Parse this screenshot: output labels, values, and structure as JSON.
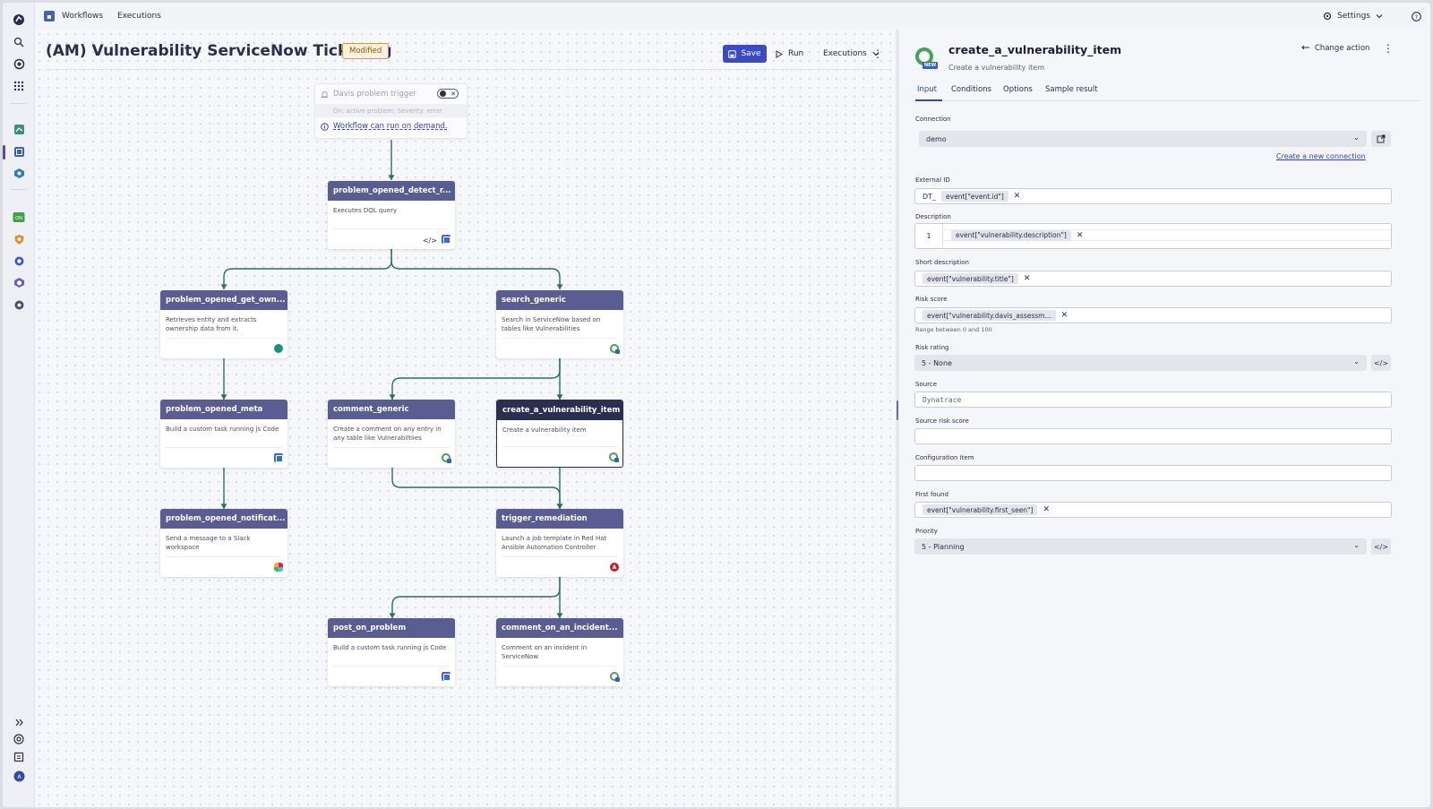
{
  "topbar": {
    "app_name": "Workflows",
    "nav_executions": "Executions",
    "settings_label": "Settings"
  },
  "editor": {
    "title": "(AM) Vulnerability ServiceNow Ticketing",
    "modified_badge": "Modified",
    "save_label": "Save",
    "run_label": "Run",
    "executions_label": "Executions"
  },
  "trigger": {
    "title": "Davis problem trigger",
    "subtitle": "On: active problem; Severity: error",
    "on_demand_link": "Workflow can run on demand."
  },
  "nodes": [
    {
      "title": "problem_opened_detect_r...",
      "desc": "Executes DQL query",
      "icon": "code-and-dynatrace-icons"
    },
    {
      "title": "problem_opened_get_own...",
      "desc": "Retrieves entity and extracts ownership data from it.",
      "icon": "globe-icon"
    },
    {
      "title": "search_generic",
      "desc": "Search in ServiceNow based on tables like Vulnerabilities",
      "icon": "servicenow-icon"
    },
    {
      "title": "problem_opened_meta",
      "desc": "Build a custom task running js Code",
      "icon": "dynatrace-icon"
    },
    {
      "title": "comment_generic",
      "desc": "Create a comment on any entry in any table like Vulnerabiltiies",
      "icon": "servicenow-icon"
    },
    {
      "title": "create_a_vulnerability_item",
      "desc": "Create a vulnerability item",
      "icon": "servicenow-icon"
    },
    {
      "title": "problem_opened_notificat...",
      "desc": "Send a message to a Slack workspace",
      "icon": "slack-icon"
    },
    {
      "title": "trigger_remediation",
      "desc": "Launch a job template in Red Hat Ansible Automation Controller",
      "icon": "ansible-icon"
    },
    {
      "title": "post_on_problem",
      "desc": "Build a custom task running js Code",
      "icon": "dynatrace-icon"
    },
    {
      "title": "comment_on_an_incident...",
      "desc": "Comment on an incident in ServiceNow",
      "icon": "servicenow-icon"
    }
  ],
  "panel": {
    "title": "create_a_vulnerability_item",
    "subtitle": "Create a vulnerability item",
    "new_badge": "NEW",
    "change_action": "Change action",
    "tabs": [
      "Input",
      "Conditions",
      "Options",
      "Sample result"
    ],
    "connection": {
      "label": "Connection",
      "value": "demo",
      "create_link": "Create a new connection"
    },
    "external_id": {
      "label": "External ID",
      "prefix": "DT_",
      "chip": "event[\"event.id\"]"
    },
    "description": {
      "label": "Description",
      "line_no": "1",
      "chip": "event[\"vulnerability.description\"]"
    },
    "short_description": {
      "label": "Short description",
      "chip": "event[\"vulnerability.title\"]"
    },
    "risk_score": {
      "label": "Risk score",
      "chip": "event[\"vulnerability.davis_assessm...",
      "help": "Range between 0 and 100"
    },
    "risk_rating": {
      "label": "Risk rating",
      "value": "5 - None"
    },
    "source": {
      "label": "Source",
      "value": "Dynatrace"
    },
    "source_risk_score": {
      "label": "Source risk score",
      "value": ""
    },
    "configuration_item": {
      "label": "Configuration item",
      "value": ""
    },
    "first_found": {
      "label": "First found",
      "chip": "event[\"vulnerability.first_seen\"]"
    },
    "priority": {
      "label": "Priority",
      "value": "5 - Planning"
    }
  },
  "colors": {
    "node_header": "#5a5d91",
    "node_header_selected": "#2b2e4e",
    "edge": "#2e6e5a",
    "accent": "#3a4cc0"
  }
}
